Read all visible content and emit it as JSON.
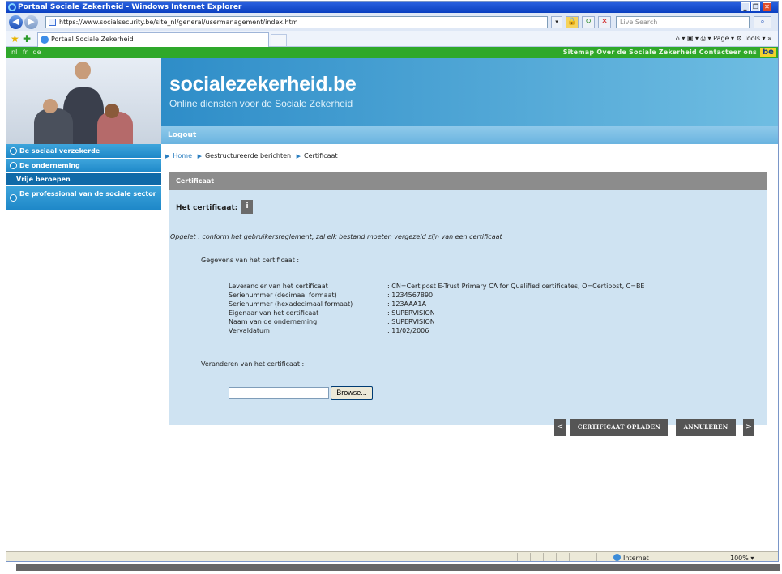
{
  "window": {
    "title": "Portaal Sociale Zekerheid - Windows Internet Explorer",
    "min": "_",
    "max": "❐",
    "close": "✕"
  },
  "browser": {
    "back": "◀",
    "forward": "▶",
    "url": "https://www.socialsecurity.be/site_nl/general/usermanagement/index.htm",
    "refresh": "↻",
    "stop": "✕",
    "search_placeholder": "Live Search",
    "search_btn": "⌕",
    "tab_title": "Portaal Sociale Zekerheid",
    "commands": "⌂ ▾  ▣ ▾  ⎙ ▾  Page ▾  ⚙ Tools ▾  »"
  },
  "topbar": {
    "languages": [
      "nl",
      "fr",
      "de"
    ],
    "links": "Sitemap  Over de Sociale Zekerheid  Contacteer ons",
    "flag": "be"
  },
  "header": {
    "brand": "socialezekerheid.be",
    "tagline": "Online diensten voor de Sociale Zekerheid",
    "logout": "Logout"
  },
  "sidebar": {
    "items": [
      {
        "label": "De sociaal verzekerde"
      },
      {
        "label": "De onderneming"
      },
      {
        "label": "Vrije beroepen"
      },
      {
        "label": "De professional van de sociale sector"
      }
    ]
  },
  "breadcrumb": {
    "home": "Home",
    "step2": "Gestructureerde berichten",
    "step3": "Certificaat"
  },
  "panel": {
    "header": "Certificaat",
    "cert_label": "Het certificaat:",
    "info": "i",
    "notice": "Opgelet : conform het gebruikersreglement, zal elk bestand moeten vergezeld zijn van een certificaat",
    "gegevens": "Gegevens van het certificaat :",
    "fields": [
      {
        "key": "Leverancier van het certificaat",
        "value": ": CN=Certipost E-Trust Primary CA for Qualified certificates, O=Certipost, C=BE"
      },
      {
        "key": "Serienummer (decimaal formaat)",
        "value": ": 1234567890"
      },
      {
        "key": "Serienummer (hexadecimaal formaat)",
        "value": ": 123AAA1A"
      },
      {
        "key": "Eigenaar van het certificaat",
        "value": ": SUPERVISION"
      },
      {
        "key": "Naam van de onderneming",
        "value": ": SUPERVISION"
      },
      {
        "key": "Vervaldatum",
        "value": ": 11/02/2006"
      }
    ],
    "veranderen": "Veranderen van het certificaat :",
    "browse": "Browse...",
    "prev": "<",
    "upload": "CERTIFICAAT OPLADEN",
    "cancel": "ANNULEREN",
    "next": ">"
  },
  "status": {
    "zone": "Internet",
    "zoom": "100%"
  }
}
